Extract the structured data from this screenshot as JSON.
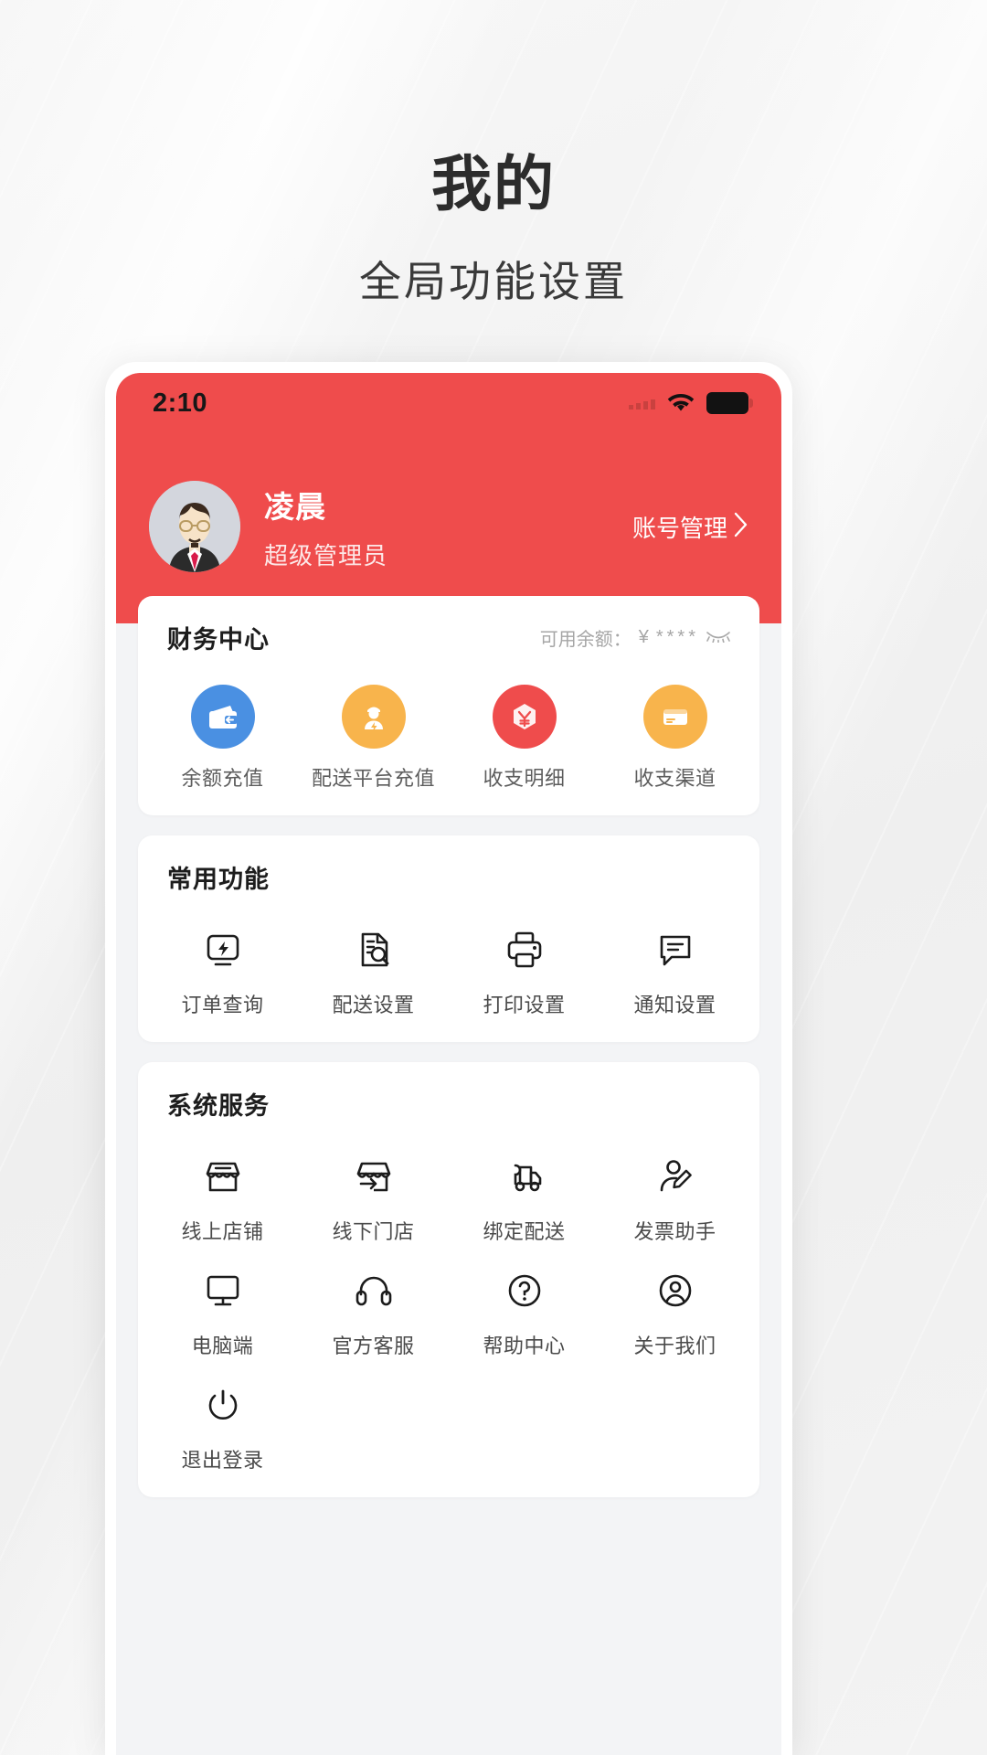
{
  "page": {
    "title": "我的",
    "subtitle": "全局功能设置"
  },
  "theme": {
    "brand_red": "#EF4C4C",
    "page_bg": "#F3F4F6",
    "card_bg": "#FFFFFF"
  },
  "statusbar": {
    "time": "2:10",
    "signal_icon": "signal-dots-icon",
    "wifi_icon": "wifi-icon",
    "battery_icon": "battery-full-icon"
  },
  "profile": {
    "avatar_icon": "avatar-man-with-glasses",
    "name": "凌晨",
    "role": "超级管理员",
    "account_link": "账号管理",
    "chevron": "›"
  },
  "finance": {
    "title": "财务中心",
    "balance_label": "可用余额：",
    "currency": "¥",
    "balance_masked": "****",
    "eye_icon": "eye-closed-icon",
    "items": [
      {
        "label": "余额充值",
        "icon": "wallet-icon",
        "color": "#4A90E2"
      },
      {
        "label": "配送平台充值",
        "icon": "courier-person-icon",
        "color": "#F8B44C"
      },
      {
        "label": "收支明细",
        "icon": "yuan-hexagon-icon",
        "color": "#EF4C4C"
      },
      {
        "label": "收支渠道",
        "icon": "card-icon",
        "color": "#F8B44C"
      }
    ]
  },
  "common": {
    "title": "常用功能",
    "items": [
      {
        "label": "订单查询",
        "icon": "order-query-icon"
      },
      {
        "label": "配送设置",
        "icon": "delivery-settings-icon"
      },
      {
        "label": "打印设置",
        "icon": "printer-icon"
      },
      {
        "label": "通知设置",
        "icon": "message-icon"
      }
    ]
  },
  "system": {
    "title": "系统服务",
    "items": [
      {
        "label": "线上店铺",
        "icon": "online-shop-icon"
      },
      {
        "label": "线下门店",
        "icon": "offline-store-icon"
      },
      {
        "label": "绑定配送",
        "icon": "delivery-truck-icon"
      },
      {
        "label": "发票助手",
        "icon": "invoice-assistant-icon"
      },
      {
        "label": "电脑端",
        "icon": "desktop-icon"
      },
      {
        "label": "官方客服",
        "icon": "headset-icon"
      },
      {
        "label": "帮助中心",
        "icon": "question-circle-icon"
      },
      {
        "label": "关于我们",
        "icon": "user-circle-icon"
      },
      {
        "label": "退出登录",
        "icon": "power-icon"
      }
    ]
  }
}
